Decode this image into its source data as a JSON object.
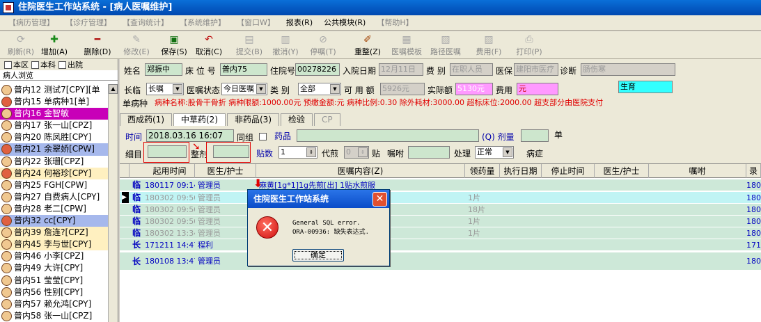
{
  "window": {
    "title": "住院医生工作站系统 - [病人医嘱维护]"
  },
  "menu": [
    "【病历管理】",
    "【诊疗管理】",
    "【查询统计】",
    "【系统维护】",
    "【窗口W】",
    "报表(R)",
    "公共模块(R)",
    "【帮助H】"
  ],
  "toolbar": [
    {
      "label": "刷新(R)",
      "icon": "refresh-icon",
      "on": false
    },
    {
      "label": "增加(A)",
      "icon": "plus-icon",
      "on": true
    },
    {
      "label": "删除(D)",
      "icon": "minus-icon",
      "on": true
    },
    {
      "label": "修改(E)",
      "icon": "edit-icon",
      "on": false
    },
    {
      "label": "保存(S)",
      "icon": "save-icon",
      "on": true
    },
    {
      "label": "取消(C)",
      "icon": "undo-icon",
      "on": true
    },
    {
      "label": "提交(B)",
      "icon": "submit-icon",
      "on": false
    },
    {
      "label": "撤消(Y)",
      "icon": "revoke-icon",
      "on": false
    },
    {
      "label": "停嘱(T)",
      "icon": "stop-icon",
      "on": false
    },
    {
      "label": "重整(Z)",
      "icon": "reorg-icon",
      "on": true
    },
    {
      "label": "医嘱模板",
      "icon": "template-icon",
      "on": false
    },
    {
      "label": "路径医嘱",
      "icon": "path-icon",
      "on": false
    },
    {
      "label": "费用(F)",
      "icon": "fee-icon",
      "on": false
    },
    {
      "label": "打印(P)",
      "icon": "print-icon",
      "on": false
    }
  ],
  "sidebar": {
    "filters": [
      "本区",
      "本科",
      "出院"
    ],
    "title": "病人浏览",
    "patients": [
      {
        "label": "普内12 测试7[CPY][单",
        "style": "",
        "f": false
      },
      {
        "label": "普内15 单病种1[单]",
        "style": "",
        "f": true
      },
      {
        "label": "普内16 金智敏",
        "style": "mag",
        "f": false
      },
      {
        "label": "普内17 张一山[CPZ]",
        "style": "",
        "f": false
      },
      {
        "label": "普内20 陈凤胜[CPY]",
        "style": "",
        "f": false
      },
      {
        "label": "普内21 余翠娇[CPW]",
        "style": "sel",
        "f": true
      },
      {
        "label": "普内22 张珊[CPZ]",
        "style": "",
        "f": false
      },
      {
        "label": "普内24 何裕珍[CPY]",
        "style": "yel",
        "f": true
      },
      {
        "label": "普内25 FGH[CPW]",
        "style": "",
        "f": false
      },
      {
        "label": "普内27 自费病人[CPY]",
        "style": "",
        "f": false
      },
      {
        "label": "普内28 老二[CPW]",
        "style": "",
        "f": false
      },
      {
        "label": "普内32 cc[CPY]",
        "style": "sel",
        "f": true
      },
      {
        "label": "普内39 詹连?[CPZ]",
        "style": "yel",
        "f": false
      },
      {
        "label": "普内45 李与世[CPY]",
        "style": "yel",
        "f": false
      },
      {
        "label": "普内46 小李[CPZ]",
        "style": "",
        "f": false
      },
      {
        "label": "普内49 大许[CPY]",
        "style": "",
        "f": false
      },
      {
        "label": "普内51 莹莹[CPY]",
        "style": "",
        "f": false
      },
      {
        "label": "普内56 性别[CPY]",
        "style": "",
        "f": false
      },
      {
        "label": "普内57 赖允鸿[CPY]",
        "style": "",
        "f": false
      },
      {
        "label": "普内58 张一山[CPZ]",
        "style": "",
        "f": false
      }
    ]
  },
  "form": {
    "name_label": "姓名",
    "name": "郑振中",
    "bed_label": "床 位 号",
    "bed": "普内75",
    "admit_no_label": "住院号",
    "admit_no": "00278226",
    "admit_date_label": "入院日期",
    "admit_date": "12月11日",
    "fee_type_label": "费 别",
    "fee_type": "在职人员",
    "insurance_label": "医保",
    "insurance": "建阳市医疗",
    "diagnosis_label": "诊断",
    "diagnosis": "肠伤寒",
    "term_label": "长临",
    "term": "长嘱",
    "order_status_label": "医嘱状态",
    "order_status": "今日医嘱",
    "category_label": "类 别",
    "category": "全部",
    "available_label": "可 用 额",
    "available": "5926元",
    "actual_label": "实际额",
    "actual": "5130元",
    "cost_label": "费用",
    "cost": "元",
    "birth": "生育",
    "disease_label": "单病种",
    "disease_info": "病种名称:股骨干骨折 病种限额:1000.00元 预缴金额:元 病种比例:0.30 除外耗材:3000.00 超标床位:2000.00 超支部分由医院支付"
  },
  "tabs": [
    "西成药(1)",
    "中草药(2)",
    "非药品(3)",
    "检验",
    "CP"
  ],
  "entry": {
    "time_label": "时间",
    "time": "2018.03.16 16:07",
    "same_group_label": "同组",
    "drug_label": "药品",
    "dose_label": "(Q) 剂量",
    "unit": "单",
    "detail_label": "细目",
    "whole_label": "整剂",
    "doses_label": "贴数",
    "doses": "1",
    "decoct_label": "代煎",
    "decoct": "0",
    "tie": "贴",
    "note_label": "嘱咐",
    "handle_label": "处理",
    "handle": "正常",
    "symptom_label": "病症"
  },
  "grid": {
    "headers": [
      "起用时间",
      "医生/护士",
      "医嘱内容(Z)",
      "领药量",
      "执行日期",
      "停止时间",
      "医生/护士",
      "嘱咐",
      "录"
    ],
    "rows": [
      {
        "type": "临",
        "start": "180117 09:14",
        "doctor": "管理员",
        "content": "麻黄[1g*1]1g先煎[出] 1贴水煎服",
        "qty": "",
        "tail": "18011",
        "style": "gn",
        "dim": false,
        "marker": false
      },
      {
        "type": "临",
        "start": "180302 09:50",
        "doctor": "管理员",
        "content": "服",
        "qty": "1片",
        "tail": "18030",
        "style": "cy",
        "dim": true,
        "marker": true
      },
      {
        "type": "临",
        "start": "180302 09:50",
        "doctor": "管理员",
        "content": "服18天",
        "qty": "18片",
        "tail": "18030",
        "style": "gn",
        "dim": true,
        "marker": false
      },
      {
        "type": "临",
        "start": "180302 09:50",
        "doctor": "管理员",
        "content": "服",
        "qty": "1片",
        "tail": "18030",
        "style": "gn",
        "dim": true,
        "marker": false
      },
      {
        "type": "临",
        "start": "180302 13:34",
        "doctor": "管理员",
        "content": "服",
        "qty": "1片",
        "tail": "18030",
        "style": "gn",
        "dim": true,
        "marker": false
      },
      {
        "type": "长",
        "start": "171211 14:47",
        "doctor": "程利",
        "content": "",
        "qty": "",
        "tail": "17121",
        "style": "gn",
        "dim": false,
        "marker": false
      },
      {
        "type": "长",
        "start": "180108 13:47",
        "doctor": "管理员",
        "content": "]100mg qd",
        "qty": "",
        "tail": "18010",
        "style": "gn",
        "dim": false,
        "marker": false
      }
    ]
  },
  "dialog": {
    "title": "住院医生工作站系统",
    "line1": "General SQL error.",
    "line2": "ORA-00936: 缺失表达式.",
    "ok": "确定"
  }
}
